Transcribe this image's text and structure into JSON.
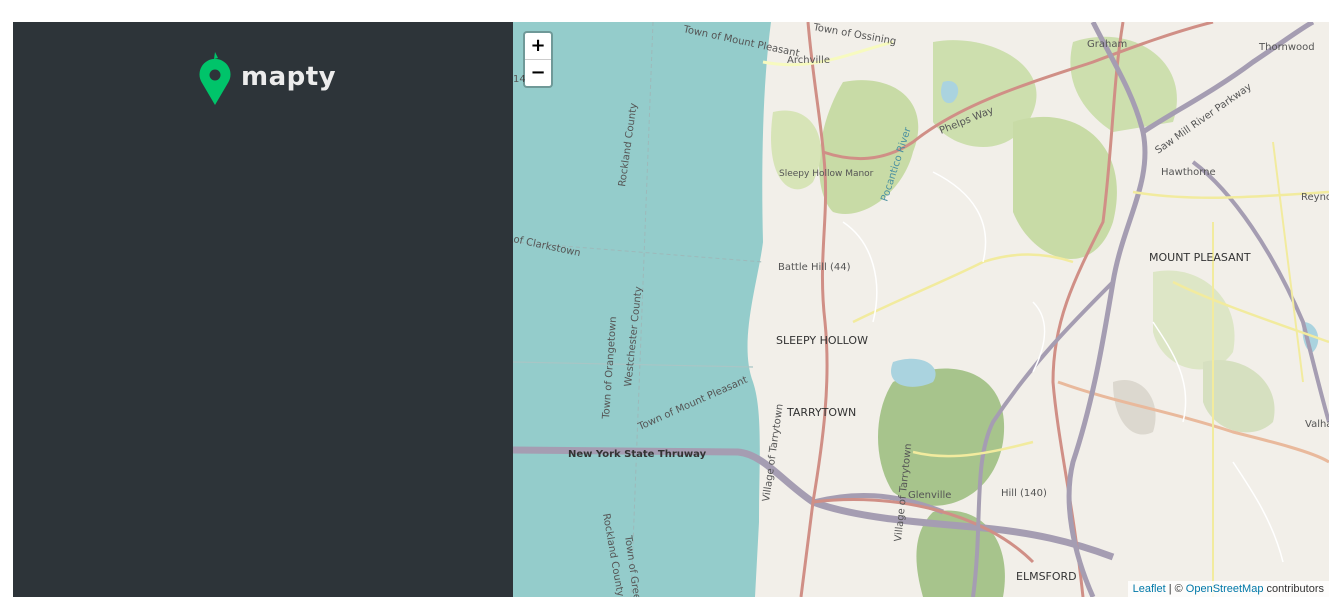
{
  "app": {
    "logo_text": "mapty",
    "brand_color": "#00c46a",
    "sidebar_color": "#2d3439"
  },
  "map": {
    "zoom_in_label": "+",
    "zoom_out_label": "−",
    "attribution": {
      "leaflet_link": "Leaflet",
      "separator": "| ©",
      "osm_link": "OpenStreetMap",
      "contributors": "contributors"
    },
    "labels": {
      "town_mount_pleasant_top": "Town of Mount Pleasant",
      "town_ossining": "Town of Ossining",
      "graham": "Graham",
      "thornwood": "Thornwood",
      "archville": "Archville",
      "phelps_way": "Phelps Way",
      "saw_mill": "Saw Mill River Parkway",
      "rockland_county_top": "Rockland County",
      "pocantico_river": "Pocantico River",
      "sleepy_hollow_manor": "Sleepy Hollow Manor",
      "hawthorne": "Hawthorne",
      "reyno": "Reyno",
      "clarkstown": "of Clarkstown",
      "battle_hill": "Battle Hill (44)",
      "mount_pleasant": "MOUNT PLEASANT",
      "westchester_county": "Westchester County",
      "town_orangetown": "Town of Orangetown",
      "sleepy_hollow": "SLEEPY HOLLOW",
      "town_mount_pleasant_bottom": "Town of Mount Pleasant",
      "tarrytown": "TARRYTOWN",
      "valhalla": "Valhalla",
      "ny_thruway": "New York State Thruway",
      "village_tarrytown_1": "Village of Tarrytown",
      "village_tarrytown_2": "Village of Tarrytown",
      "glenville": "Glenville",
      "hill_140": "Hill (140)",
      "rockland_county_bottom": "Rockland County",
      "town_greenburgh": "Town of Gree",
      "elmsford": "ELMSFORD",
      "edge_14": "14"
    }
  }
}
